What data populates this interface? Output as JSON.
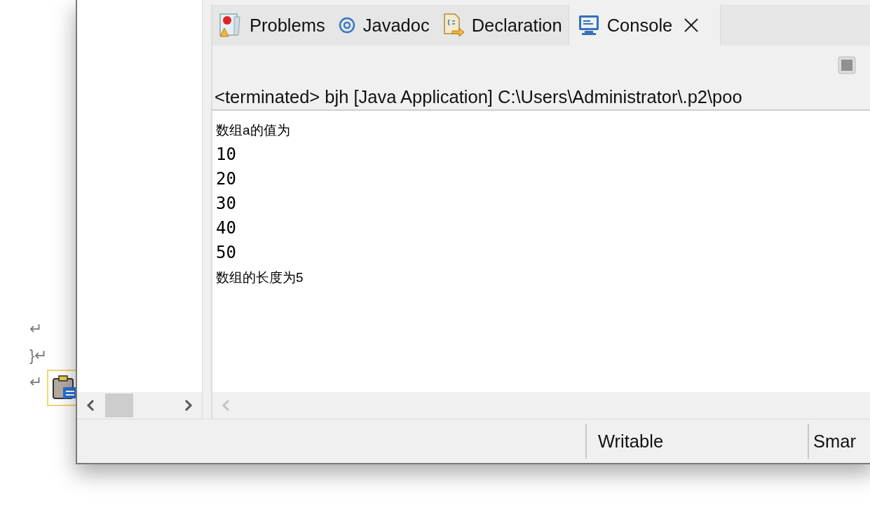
{
  "document": {
    "lines": [
      {
        "text": "↵"
      },
      {
        "text": "}↵"
      },
      {
        "text": "↵"
      }
    ]
  },
  "window": {
    "tabs": [
      {
        "label": "Problems",
        "kind": "problems",
        "selected": false,
        "closable": false
      },
      {
        "label": "Javadoc",
        "kind": "javadoc",
        "selected": false,
        "closable": false
      },
      {
        "label": "Declaration",
        "kind": "declaration",
        "selected": false,
        "closable": false
      },
      {
        "label": "Console",
        "kind": "console",
        "selected": true,
        "closable": true
      }
    ],
    "console_header": "<terminated> bjh [Java Application] C:\\Users\\Administrator\\.p2\\poo",
    "console_output": [
      {
        "text": "数组a的值为",
        "kind": "cjk"
      },
      {
        "text": "10",
        "kind": "mono"
      },
      {
        "text": "20",
        "kind": "mono"
      },
      {
        "text": "30",
        "kind": "mono"
      },
      {
        "text": "40",
        "kind": "mono"
      },
      {
        "text": "50",
        "kind": "mono"
      },
      {
        "text": "数组的长度为5",
        "kind": "cjk"
      }
    ],
    "status_bar": [
      "Writable",
      "Smar"
    ]
  }
}
